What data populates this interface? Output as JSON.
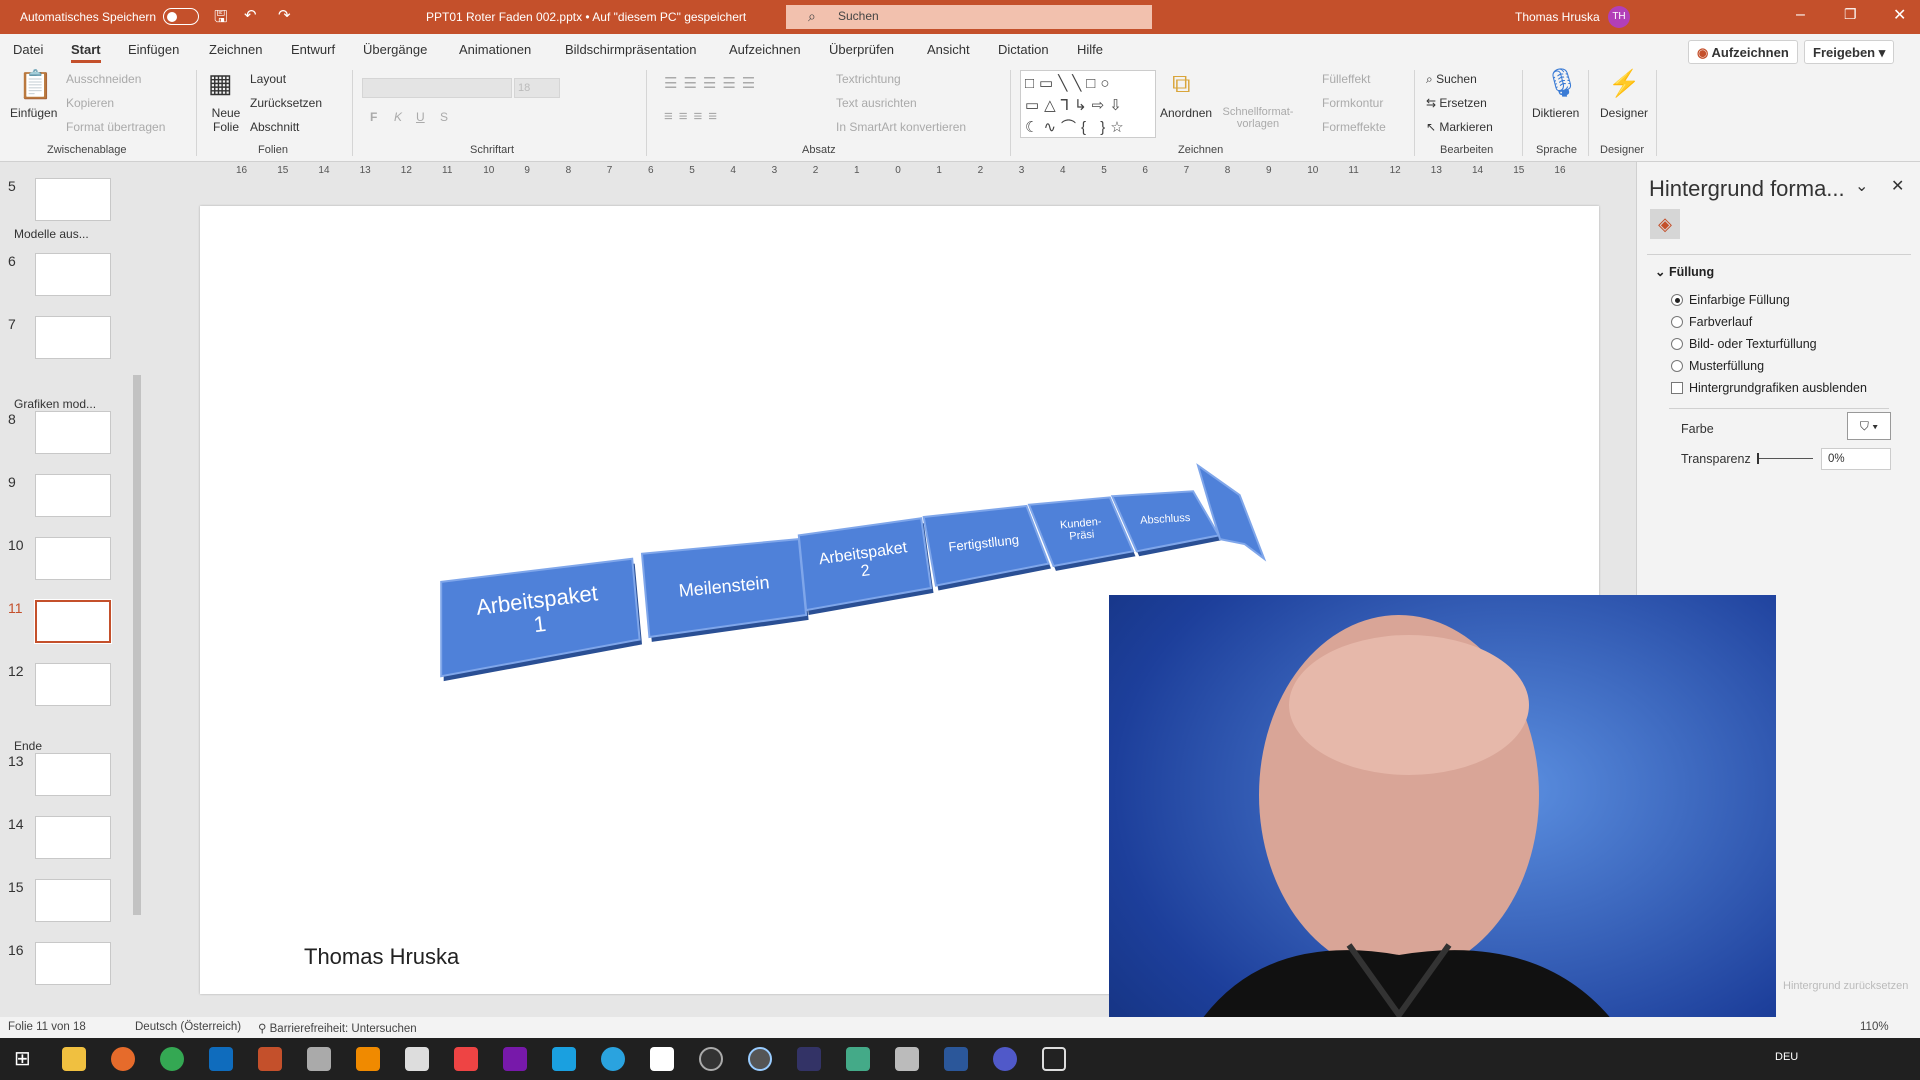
{
  "titlebar": {
    "autosave": "Automatisches Speichern",
    "filename": "PPT01 Roter Faden 002.pptx • Auf \"diesem PC\" gespeichert",
    "search_placeholder": "Suchen",
    "user": "Thomas Hruska",
    "initials": "TH"
  },
  "tabs": [
    "Datei",
    "Start",
    "Einfügen",
    "Zeichnen",
    "Entwurf",
    "Übergänge",
    "Animationen",
    "Bildschirmpräsentation",
    "Aufzeichnen",
    "Überprüfen",
    "Ansicht",
    "Dictation",
    "Hilfe"
  ],
  "ribbon_right": {
    "record": "Aufzeichnen",
    "share": "Freigeben"
  },
  "ribbon": {
    "clipboard": {
      "paste": "Einfügen",
      "cut": "Ausschneiden",
      "copy": "Kopieren",
      "format": "Format übertragen",
      "group": "Zwischenablage"
    },
    "slides": {
      "new": "Neue Folie",
      "layout": "Layout",
      "reset": "Zurücksetzen",
      "section": "Abschnitt",
      "group": "Folien"
    },
    "font": {
      "bold": "F",
      "italic": "K",
      "underline": "U",
      "shadow": "S",
      "group": "Schriftart",
      "size": "18"
    },
    "paragraph": {
      "direction": "Textrichtung",
      "align": "Text ausrichten",
      "smartart": "In SmartArt konvertieren",
      "group": "Absatz"
    },
    "drawing": {
      "arrange": "Anordnen",
      "quick": "Schnellformat-vorlagen",
      "fill": "Fülleffekt",
      "outline": "Formkontur",
      "effects": "Formeffekte",
      "group": "Zeichnen"
    },
    "editing": {
      "find": "Suchen",
      "replace": "Ersetzen",
      "select": "Markieren",
      "group": "Bearbeiten"
    },
    "voice": {
      "dictate": "Diktieren",
      "group": "Sprache"
    },
    "designer": {
      "label": "Designer",
      "group": "Designer"
    }
  },
  "ruler_ticks": [
    "16",
    "15",
    "14",
    "13",
    "12",
    "11",
    "10",
    "9",
    "8",
    "7",
    "6",
    "5",
    "4",
    "3",
    "2",
    "1",
    "0",
    "1",
    "2",
    "3",
    "4",
    "5",
    "6",
    "7",
    "8",
    "9",
    "10",
    "11",
    "12",
    "13",
    "14",
    "15",
    "16"
  ],
  "slides_panel": {
    "sections": [
      "Modelle aus...",
      "Grafiken mod...",
      "Ende"
    ],
    "numbers": [
      "5",
      "6",
      "7",
      "8",
      "9",
      "10",
      "11",
      "12",
      "13",
      "14",
      "15",
      "16"
    ],
    "selected": "11"
  },
  "slide": {
    "boxes": [
      "Arbeitspaket 1",
      "Meilenstein",
      "Arbeitspaket 2",
      "Fertigstllung",
      "Kunden-Präsi",
      "Abschluss"
    ],
    "author": "Thomas Hruska",
    "box_color": "#4f81d9"
  },
  "pane": {
    "title": "Hintergrund forma...",
    "section": "Füllung",
    "options": [
      "Einfarbige Füllung",
      "Farbverlauf",
      "Bild- oder Texturfüllung",
      "Musterfüllung"
    ],
    "selected": "Einfarbige Füllung",
    "hide_graphics": "Hintergrundgrafiken ausblenden",
    "color_label": "Farbe",
    "transparency_label": "Transparenz",
    "transparency": "0%",
    "reset": "Hintergrund zurücksetzen"
  },
  "status": {
    "slide": "Folie 11 von 18",
    "language": "Deutsch (Österreich)",
    "accessibility": "Barrierefreiheit: Untersuchen",
    "zoom": "110%",
    "lang_tray": "DEU"
  },
  "colors": {
    "accent": "#c4502b",
    "taskbar": "#202020"
  }
}
